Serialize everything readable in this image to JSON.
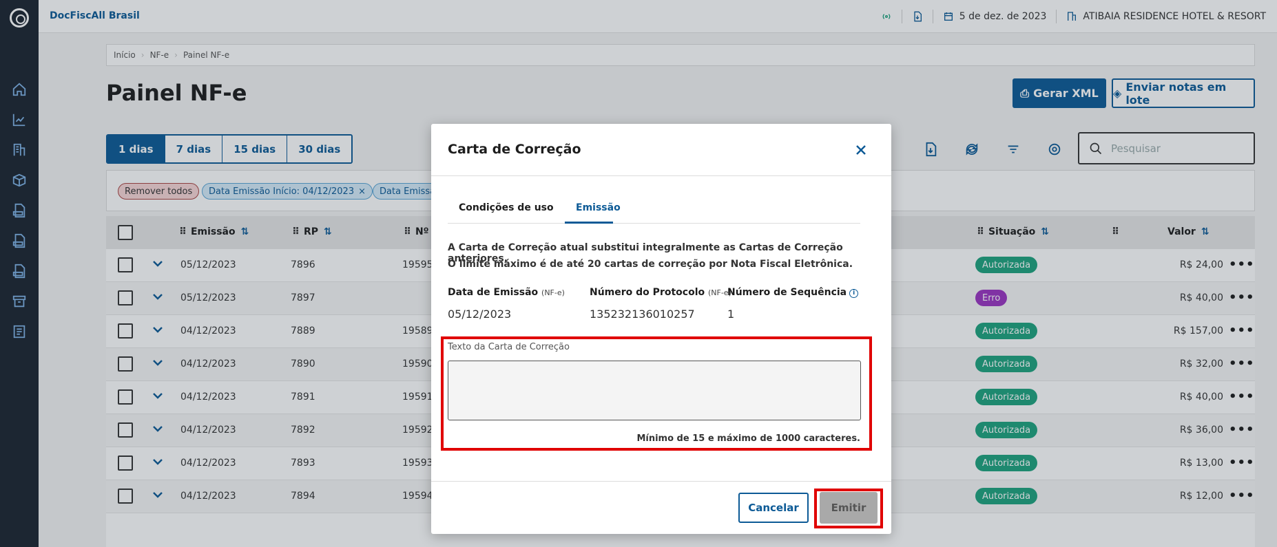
{
  "app": {
    "title": "DocFiscAll Brasil"
  },
  "topbar": {
    "date": "5 de dez. de 2023",
    "company": "ATIBAIA RESIDENCE HOTEL & RESORT"
  },
  "breadcrumb": [
    "Início",
    "NF-e",
    "Painel NF-e"
  ],
  "page": {
    "title": "Painel NF-e",
    "gerar_xml": "Gerar XML",
    "enviar_lote": "Enviar notas em lote",
    "periods": [
      "1 dias",
      "7 dias",
      "15 dias",
      "30 dias"
    ],
    "active_period": "1 dias",
    "search_placeholder": "Pesquisar"
  },
  "filters": {
    "remove_all": "Remover todos",
    "chip1": "Data Emissão Início: 04/12/2023",
    "chip2": "Data Emissã"
  },
  "table": {
    "columns": {
      "emissao": "Emissão",
      "rp": "RP",
      "numero": "Nº",
      "situacao": "Situação",
      "valor": "Valor"
    },
    "rows": [
      {
        "emissao": "05/12/2023",
        "rp": "7896",
        "numero": "19595",
        "situacao": "Autorizada",
        "valor": "R$ 24,00"
      },
      {
        "emissao": "05/12/2023",
        "rp": "7897",
        "numero": "",
        "situacao": "Erro",
        "valor": "R$ 40,00"
      },
      {
        "emissao": "04/12/2023",
        "rp": "7889",
        "numero": "19589",
        "situacao": "Autorizada",
        "valor": "R$ 157,00"
      },
      {
        "emissao": "04/12/2023",
        "rp": "7890",
        "numero": "19590",
        "situacao": "Autorizada",
        "valor": "R$ 32,00"
      },
      {
        "emissao": "04/12/2023",
        "rp": "7891",
        "numero": "19591",
        "situacao": "Autorizada",
        "valor": "R$ 40,00"
      },
      {
        "emissao": "04/12/2023",
        "rp": "7892",
        "numero": "19592",
        "situacao": "Autorizada",
        "valor": "R$ 36,00"
      },
      {
        "emissao": "04/12/2023",
        "rp": "7893",
        "numero": "19593",
        "situacao": "Autorizada",
        "valor": "R$ 13,00"
      },
      {
        "emissao": "04/12/2023",
        "rp": "7894",
        "numero": "19594",
        "situacao": "Autorizada",
        "valor": "R$ 12,00"
      }
    ]
  },
  "modal": {
    "title": "Carta de Correção",
    "tabs": [
      "Condições de uso",
      "Emissão"
    ],
    "active_tab": "Emissão",
    "line1": "A Carta de Correção atual substitui integralmente as Cartas de Correção anteriores.",
    "line2": "O limite máximo é de até 20 cartas de correção por Nota Fiscal Eletrônica.",
    "data_emissao_label": "Data de Emissão",
    "numero_protocolo_label": "Número do Protocolo",
    "nfe_suffix": "(NF-e)",
    "numero_sequencia_label": "Número de Sequência",
    "data_emissao": "05/12/2023",
    "numero_protocolo": "135232136010257",
    "numero_sequencia": "1",
    "texto_label": "Texto da Carta de Correção",
    "texto_value": "",
    "hint": "Mínimo de 15 e máximo de 1000 caracteres.",
    "cancel": "Cancelar",
    "emit": "Emitir"
  },
  "colors": {
    "primary": "#0c5a96",
    "success": "#1ea37e",
    "error": "#9b35c2",
    "highlight": "#e00000"
  }
}
